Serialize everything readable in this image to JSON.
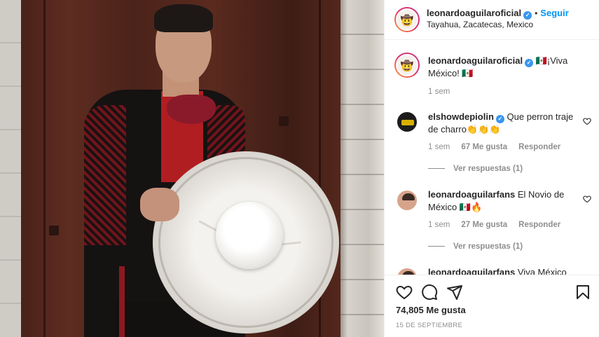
{
  "header": {
    "username": "leonardoaguilaroficial",
    "dot": "•",
    "follow_label": "Seguir",
    "location": "Tayahua, Zacatecas, Mexico",
    "verified_mark": "✓"
  },
  "caption": {
    "username": "leonardoaguilaroficial",
    "text": "🇲🇽¡Viva México! 🇲🇽",
    "time": "1 sem"
  },
  "comments": [
    {
      "username": "elshowdepiolin",
      "text": "Que perron traje de charro👏👏👏",
      "time": "1 sem",
      "likes": "67 Me gusta",
      "reply_label": "Responder",
      "view_replies": "Ver respuestas (1)"
    },
    {
      "username": "leonardoaguilarfans",
      "text": "El Novio de México 🇲🇽🔥",
      "time": "1 sem",
      "likes": "27 Me gusta",
      "reply_label": "Responder",
      "view_replies": "Ver respuestas (1)"
    },
    {
      "username": "leonardoaguilarfans",
      "text": "Viva México"
    }
  ],
  "actions": {
    "likes": "74,805 Me gusta",
    "date": "15 DE SEPTIEMBRE"
  },
  "icons": {
    "like": "heart-icon",
    "comment": "comment-icon",
    "share": "share-icon",
    "save": "bookmark-icon",
    "comment_like": "heart-icon",
    "avatar": "sombrero-icon"
  },
  "colors": {
    "follow": "#0095f6",
    "verified": "#3897f0",
    "muted": "#8e8e8e",
    "text": "#262626"
  }
}
